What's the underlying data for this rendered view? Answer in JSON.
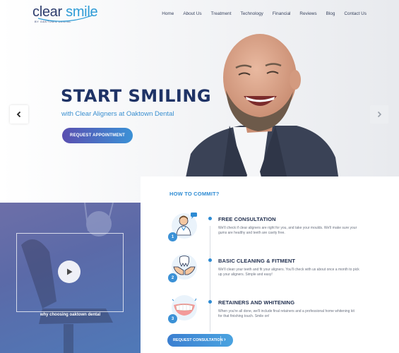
{
  "brand": {
    "name_part1": "clear",
    "name_part2": "smile",
    "tagline": "BY OAKTOWN DENTAL"
  },
  "nav": [
    {
      "label": "Home"
    },
    {
      "label": "About Us"
    },
    {
      "label": "Treatment"
    },
    {
      "label": "Technology"
    },
    {
      "label": "Financial"
    },
    {
      "label": "Reviews"
    },
    {
      "label": "Blog"
    },
    {
      "label": "Contact Us"
    }
  ],
  "hero": {
    "title": "START SMILING",
    "subtitle": "with Clear Aligners at Oaktown Dental",
    "cta": "REQUEST APPOINTMENT",
    "prev_icon": "chevron-left-icon",
    "next_icon": "chevron-right-icon"
  },
  "video": {
    "caption": "why choosing oaktown dental",
    "icon": "play-icon"
  },
  "commit": {
    "title": "HOW TO COMMIT?",
    "steps": [
      {
        "number": "1",
        "title": "FREE CONSULTATION",
        "text": "We'll check if clear aligners are right for you, and take your moulds. We'll make sure your gums are healthy and teeth are cavity free.",
        "icon": "dentist-icon"
      },
      {
        "number": "2",
        "title": "BASIC CLEANING & FITMENT",
        "text": "We'll clean your teeth and fit your aligners. You'll check with us about once a month to pick up your aligners. Simple and easy!",
        "icon": "tooth-care-icon"
      },
      {
        "number": "3",
        "title": "RETAINERS AND WHITENING",
        "text": "When you're all done, we'll include final retainers and a professional home whitening kit for that finishing touch. Smile on!",
        "icon": "smile-teeth-icon"
      }
    ],
    "cta": "REQUEST CONSULTATION"
  },
  "colors": {
    "primary": "#1f3366",
    "accent": "#2d8bd3",
    "gradient_start": "#5a4fb0",
    "gradient_end": "#3b91d6"
  }
}
